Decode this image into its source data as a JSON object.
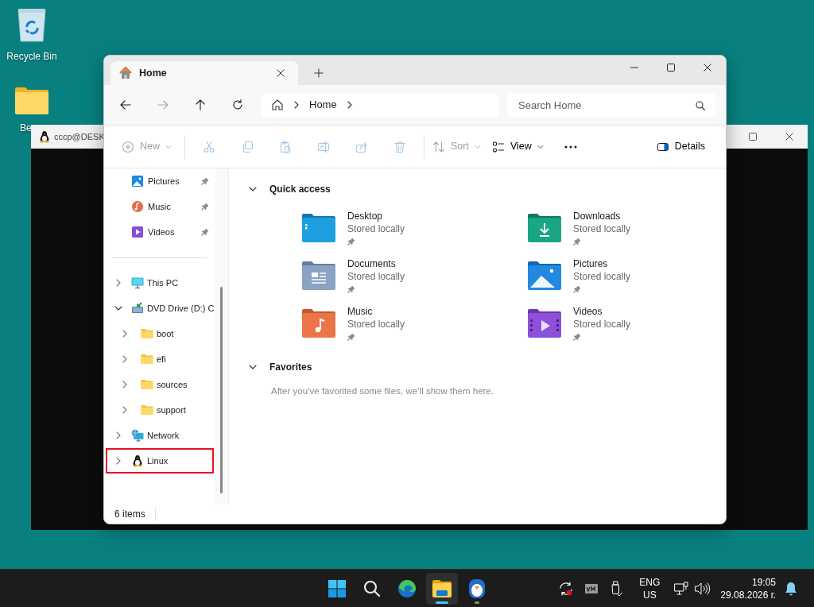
{
  "desktop_icons": [
    {
      "label": "Recycle Bin",
      "kind": "recycle"
    },
    {
      "label": "Be",
      "kind": "folder"
    }
  ],
  "terminal_window": {
    "title": "cccp@DESK"
  },
  "explorer": {
    "tabs": [
      {
        "label": "Home",
        "selected": true
      }
    ],
    "nav_buttons": [
      {
        "kind": "back",
        "disabled": false
      },
      {
        "kind": "forward",
        "disabled": true
      },
      {
        "kind": "up",
        "disabled": false
      },
      {
        "kind": "refresh",
        "disabled": false
      }
    ],
    "breadcrumbs": [
      "Home"
    ],
    "search": {
      "placeholder": "Search Home"
    },
    "command_groups": [
      [
        {
          "kind": "new",
          "label": "New",
          "disabled": true,
          "menu": true
        }
      ],
      [
        {
          "kind": "cut",
          "disabled": true,
          "menu": false
        },
        {
          "kind": "copy",
          "disabled": true,
          "menu": false
        },
        {
          "kind": "paste",
          "disabled": true,
          "menu": false
        },
        {
          "kind": "rename",
          "disabled": true,
          "menu": false
        },
        {
          "kind": "share",
          "disabled": true,
          "menu": false
        },
        {
          "kind": "delete",
          "disabled": true,
          "menu": false
        }
      ],
      [
        {
          "kind": "sort",
          "label": "Sort",
          "disabled": true,
          "menu": true
        },
        {
          "kind": "view",
          "label": "View",
          "disabled": false,
          "menu": true
        },
        {
          "kind": "more",
          "disabled": false,
          "menu": false
        }
      ]
    ],
    "details_button": {
      "label": "Details"
    },
    "sidebar": {
      "pinned": [
        {
          "label": "Pictures",
          "kind": "pictures",
          "pinned": true
        },
        {
          "label": "Music",
          "kind": "music",
          "pinned": true
        },
        {
          "label": "Videos",
          "kind": "videos",
          "pinned": true
        }
      ],
      "tree": [
        {
          "label": "This PC",
          "kind": "pc",
          "expanded": false,
          "outlined": false
        },
        {
          "label": "DVD Drive (D:) C",
          "kind": "dvd",
          "expanded": true,
          "outlined": false,
          "children": [
            {
              "label": "boot",
              "kind": "folder",
              "expanded": false,
              "outlined": false
            },
            {
              "label": "efi",
              "kind": "folder",
              "expanded": false,
              "outlined": false
            },
            {
              "label": "sources",
              "kind": "folder",
              "expanded": false,
              "outlined": false
            },
            {
              "label": "support",
              "kind": "folder",
              "expanded": false,
              "outlined": false
            }
          ]
        },
        {
          "label": "Network",
          "kind": "network",
          "expanded": false,
          "outlined": false
        },
        {
          "label": "Linux",
          "kind": "linux",
          "expanded": false,
          "outlined": true
        }
      ]
    },
    "sections": [
      {
        "title": "Quick access",
        "expanded": true,
        "items": [
          {
            "name": "Desktop",
            "status": "Stored locally",
            "kind": "desktop",
            "pinned": true
          },
          {
            "name": "Downloads",
            "status": "Stored locally",
            "kind": "downloads",
            "pinned": true
          },
          {
            "name": "Documents",
            "status": "Stored locally",
            "kind": "documents",
            "pinned": true
          },
          {
            "name": "Pictures",
            "status": "Stored locally",
            "kind": "pictures",
            "pinned": true
          },
          {
            "name": "Music",
            "status": "Stored locally",
            "kind": "music",
            "pinned": true
          },
          {
            "name": "Videos",
            "status": "Stored locally",
            "kind": "videos",
            "pinned": true
          }
        ]
      },
      {
        "title": "Favorites",
        "expanded": true,
        "message": "After you’ve favorited some files, we’ll show them here."
      }
    ],
    "status_bar": "6 items"
  },
  "taskbar": {
    "apps": [
      {
        "kind": "start",
        "active": false,
        "running": false
      },
      {
        "kind": "search",
        "active": false,
        "running": false
      },
      {
        "kind": "edge",
        "active": false,
        "running": false
      },
      {
        "kind": "explorer",
        "active": true,
        "running": true
      },
      {
        "kind": "penguin",
        "active": false,
        "running": true
      }
    ],
    "tray": [
      {
        "kind": "sync"
      },
      {
        "kind": "vm"
      },
      {
        "kind": "usb"
      }
    ],
    "language": [
      "ENG",
      "US"
    ],
    "system_icons": [
      {
        "kind": "network"
      },
      {
        "kind": "volume"
      }
    ],
    "clock": {
      "time": "19:05",
      "date": "29.08.2026 г."
    }
  }
}
